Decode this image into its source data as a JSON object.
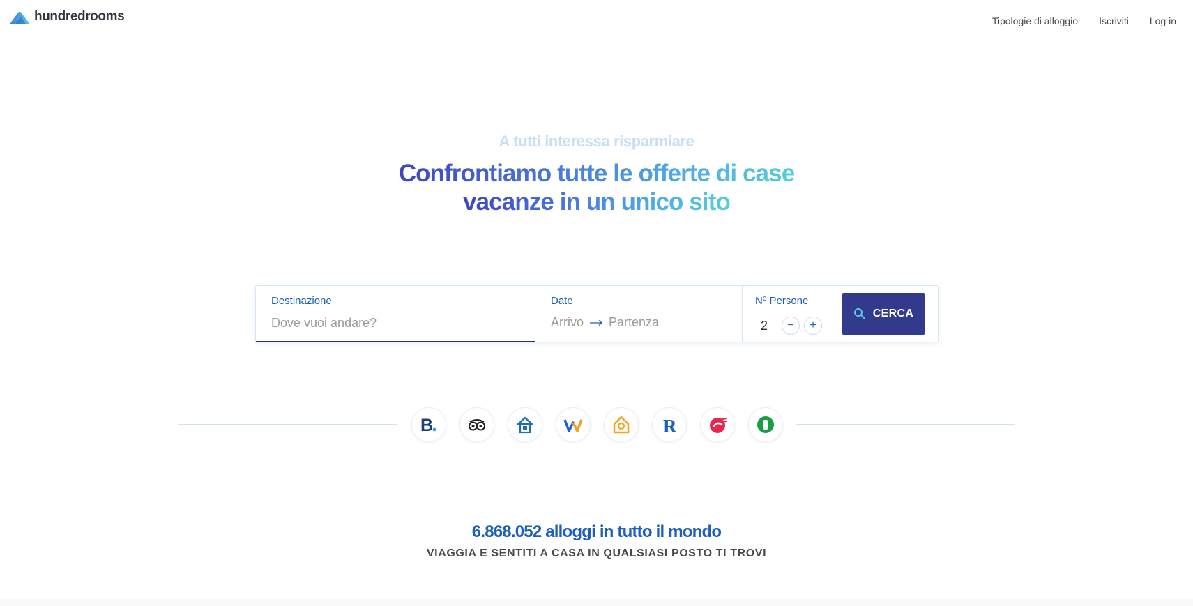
{
  "brand": {
    "name": "hundredrooms",
    "logo_icon": "cloud-logo-icon"
  },
  "nav": {
    "items": [
      {
        "label": "Tipologie di alloggio"
      },
      {
        "label": "Iscriviti"
      },
      {
        "label": "Log in"
      }
    ]
  },
  "hero": {
    "subtitle": "A tutti interessa risparmiare",
    "title_line1": "Confrontiamo tutte le offerte di case",
    "title_line2": "vacanze in un unico sito"
  },
  "search": {
    "destination": {
      "label": "Destinazione",
      "placeholder": "Dove vuoi andare?",
      "value": ""
    },
    "dates": {
      "label": "Date",
      "arrival": "Arrivo",
      "departure": "Partenza"
    },
    "persons": {
      "label": "Nº Persone",
      "value": "2",
      "minus": "−",
      "plus": "+"
    },
    "button_label": "CERCA"
  },
  "partners": [
    {
      "name": "booking-logo-icon",
      "glyph": "B."
    },
    {
      "name": "tripadvisor-logo-icon",
      "glyph": ""
    },
    {
      "name": "homeaway-logo-icon",
      "glyph": ""
    },
    {
      "name": "wimdu-logo-icon",
      "glyph": "W"
    },
    {
      "name": "housetrip-logo-icon",
      "glyph": ""
    },
    {
      "name": "rentalia-logo-icon",
      "glyph": "R"
    },
    {
      "name": "holidu-logo-icon",
      "glyph": ""
    },
    {
      "name": "idealista-logo-icon",
      "glyph": ""
    }
  ],
  "stats": {
    "count_text": "6.868.052 alloggi in tutto il mondo",
    "tagline": "VIAGGIA E SENTITI A CASA IN QUALSIASI POSTO TI TROVI"
  },
  "colors": {
    "accent": "#1d5fbf",
    "button": "#333a8e",
    "gradient_start": "#3f45c0",
    "gradient_end": "#58cfd6",
    "subtitle": "#c7dff5"
  }
}
